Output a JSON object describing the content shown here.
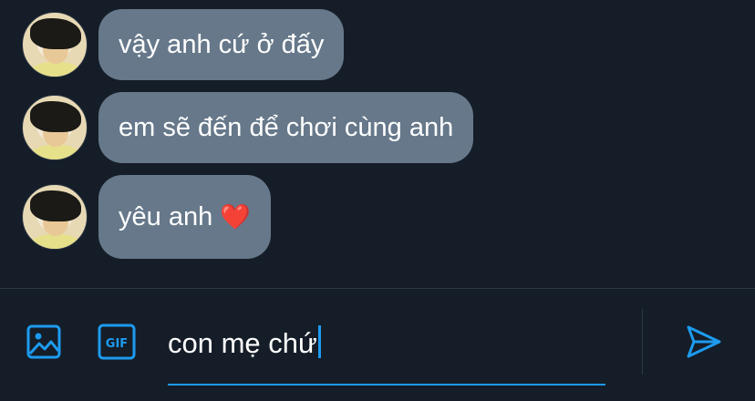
{
  "messages": [
    {
      "text": "vậy anh cứ ở đấy",
      "avatar": "user-avatar"
    },
    {
      "text": "em sẽ đến để chơi cùng anh",
      "avatar": "user-avatar"
    },
    {
      "text": "yêu anh",
      "emoji": "❤️",
      "avatar": "user-avatar"
    }
  ],
  "composer": {
    "input_value": "con mẹ chứ",
    "icons": {
      "media": "image-icon",
      "gif": "gif-icon",
      "send": "send-icon"
    },
    "gif_label": "GIF"
  },
  "colors": {
    "background": "#151d28",
    "bubble": "#66788a",
    "accent": "#1d9bf0",
    "heart": "#e0245e"
  }
}
